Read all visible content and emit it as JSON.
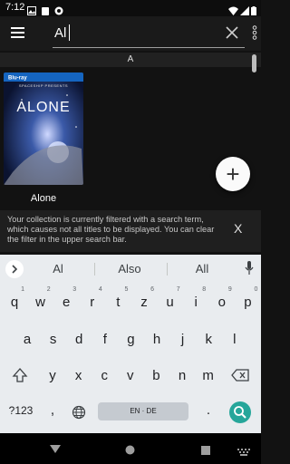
{
  "status_bar": {
    "time": "7:12"
  },
  "search": {
    "query": "Al"
  },
  "section": {
    "letter": "A"
  },
  "movie": {
    "title": "Alone",
    "cover_studio": "SPACESHIP PRESENTS",
    "cover_title": "ALONE"
  },
  "snackbar": {
    "message": "Your collection is currently filtered with a search term, which causes not all titles to be displayed. You can clear the filter in the upper search bar.",
    "dismiss": "X"
  },
  "keyboard": {
    "suggestions": [
      "Al",
      "Also",
      "All"
    ],
    "row1": [
      {
        "k": "q",
        "n": "1"
      },
      {
        "k": "w",
        "n": "2"
      },
      {
        "k": "e",
        "n": "3"
      },
      {
        "k": "r",
        "n": "4"
      },
      {
        "k": "t",
        "n": "5"
      },
      {
        "k": "z",
        "n": "6"
      },
      {
        "k": "u",
        "n": "7"
      },
      {
        "k": "i",
        "n": "8"
      },
      {
        "k": "o",
        "n": "9"
      },
      {
        "k": "p",
        "n": "0"
      }
    ],
    "row2": [
      "a",
      "s",
      "d",
      "f",
      "g",
      "h",
      "j",
      "k",
      "l"
    ],
    "row3": [
      "y",
      "x",
      "c",
      "v",
      "b",
      "n",
      "m"
    ],
    "symbols": "?123",
    "comma": ",",
    "period": ".",
    "space_label": "EN · DE"
  },
  "colors": {
    "accent": "#26a69a",
    "background": "#121212",
    "keyboard": "#e9ecef"
  }
}
